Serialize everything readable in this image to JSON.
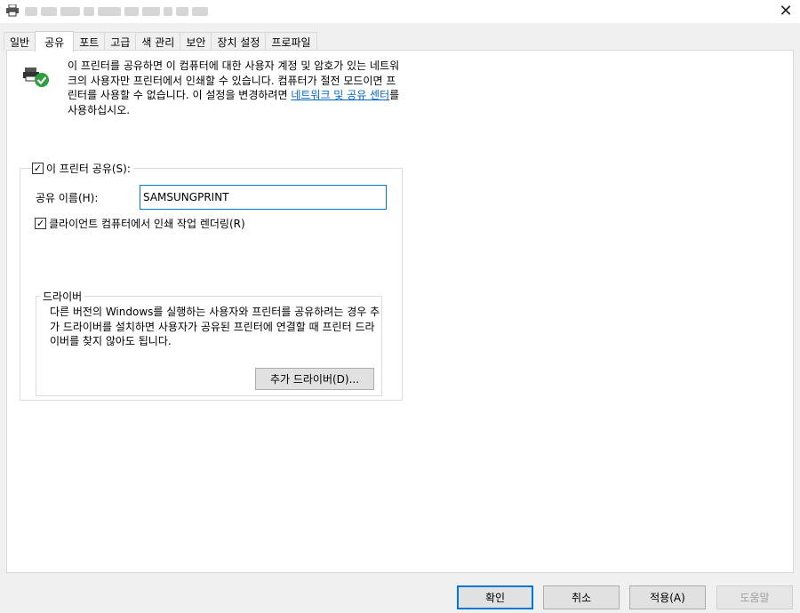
{
  "window": {
    "close_symbol": "✕",
    "icon": "printer-icon"
  },
  "tabs": [
    {
      "label": "일반"
    },
    {
      "label": "공유",
      "active": true
    },
    {
      "label": "포트"
    },
    {
      "label": "고급"
    },
    {
      "label": "색 관리"
    },
    {
      "label": "보안"
    },
    {
      "label": "장치 설정"
    },
    {
      "label": "프로파일"
    }
  ],
  "sharing": {
    "intro_icon": "shared-printer-icon",
    "intro_text": "이 프린터를 공유하면 이 컴퓨터에 대한 사용자 계정 및 암호가 있는 네트워크의 사용자만 프린터에서 인쇄할 수 있습니다. 컴퓨터가 절전 모드이면 프린터를 사용할 수 없습니다. 이 설정을 변경하려면 ",
    "intro_link": "네트워크 및 공유 센터",
    "intro_suffix": "를 사용하십시오.",
    "share_checkbox_label": "이 프린터 공유(S):",
    "share_checked": true,
    "share_name_label": "공유 이름(H):",
    "share_name_value": "SAMSUNGPRINT",
    "render_checkbox_label": "클라이언트 컴퓨터에서 인쇄 작업 렌더링(R)",
    "render_checked": true
  },
  "drivers": {
    "legend": "드라이버",
    "description": "다른 버전의 Windows를 실행하는 사용자와 프린터를 공유하려는 경우 추가 드라이버를 설치하면 사용자가 공유된 프린터에 연결할 때 프린터 드라이버를 찾지 않아도 됩니다.",
    "add_button": "추가 드라이버(D)..."
  },
  "footer": {
    "ok": "확인",
    "cancel": "취소",
    "apply": "적용(A)",
    "help": "도움말"
  },
  "colors": {
    "link": "#0066cc",
    "focus_border": "#0078d7",
    "disabled_text": "#9d9d9d"
  }
}
